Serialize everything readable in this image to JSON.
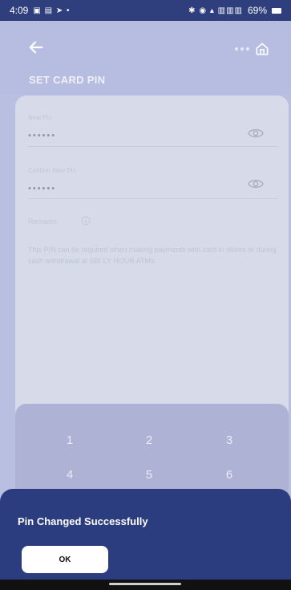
{
  "status_bar": {
    "time": "4:09",
    "left_glyphs": "▣ ▤ ➤ •",
    "right_glyphs": "✱ ◉ ▴ ▥▥▥",
    "battery": "69%"
  },
  "header": {
    "title": "SET CARD PIN"
  },
  "form": {
    "new_pin_label": "New Pin",
    "new_pin_value": "••••••",
    "confirm_pin_label": "Confirm New Pin",
    "confirm_pin_value": "••••••",
    "remarks_label": "Remarks",
    "info_text": "This PIN can be required when making payments with card in stores or during cash withdrawal at SBI LY HOUR ATMs."
  },
  "keypad": {
    "keys": [
      "1",
      "2",
      "3",
      "4",
      "5",
      "6"
    ]
  },
  "dialog": {
    "message": "Pin Changed Successfully",
    "ok_label": "OK"
  },
  "colors": {
    "primary": "#2b3d7e",
    "overlay_tint": "#b7bde0",
    "status_bar": "#2f3f7d"
  },
  "icons": [
    "back-arrow-icon",
    "home-icon",
    "eye-icon",
    "info-icon"
  ]
}
